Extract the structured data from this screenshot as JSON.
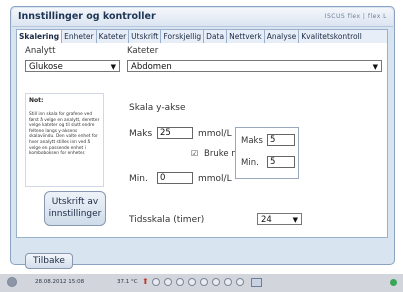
{
  "window": {
    "title": "Innstillinger og kontroller",
    "brand": "ISCUS flex | flex L"
  },
  "tabs": [
    {
      "label": "Skalering",
      "active": true
    },
    {
      "label": "Enheter"
    },
    {
      "label": "Kateter"
    },
    {
      "label": "Utskrift"
    },
    {
      "label": "Forskjellig"
    },
    {
      "label": "Data"
    },
    {
      "label": "Nettverk"
    },
    {
      "label": "Analyse"
    },
    {
      "label": "Kvalitetskontroll"
    }
  ],
  "analyte": {
    "label": "Analytt",
    "value": "Glukose"
  },
  "catheter": {
    "label": "Kateter",
    "value": "Abdomen"
  },
  "note": {
    "title": "Not:",
    "body": "Still inn skala for grafene ved først å velge en analytt, deretter velge kateter og til slutt endre feltene langs y-aksens skalaviindu. Den valte enhet for hver analytt stilles inn ved å velge en passende enhet i kombo­boksen for enheter."
  },
  "y_scale": {
    "title": "Skala y-akse",
    "max_label": "Maks",
    "max_value": "25",
    "max_unit": "mmol/L",
    "normal_checkbox_label": "Bruke normalintervall",
    "min_label": "Min.",
    "min_value": "0",
    "min_unit": "mmol/L"
  },
  "normal_range": {
    "max_label": "Maks",
    "max_value": "5",
    "min_label": "Min.",
    "min_value": "5"
  },
  "time_scale": {
    "label": "Tidsskala (timer)",
    "value": "24"
  },
  "print_button": {
    "line1": "Utskrift av",
    "line2": "innstillinger"
  },
  "back_button": {
    "label": "Tilbake"
  },
  "status": {
    "datetime": "28.08.2012 15:08",
    "temperature": "37.1 °C"
  }
}
